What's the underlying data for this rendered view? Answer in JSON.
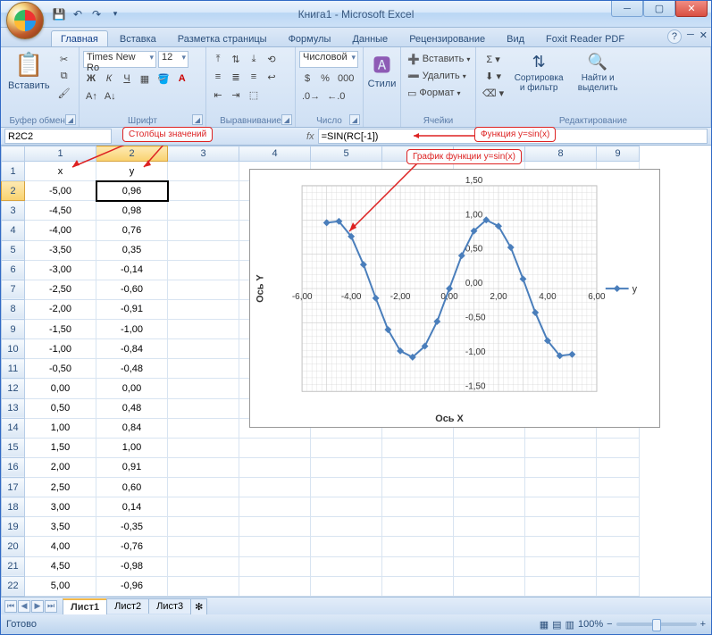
{
  "title": "Книга1 - Microsoft Excel",
  "qat_icons": [
    "save-icon",
    "undo-icon",
    "redo-icon"
  ],
  "tabs": [
    "Главная",
    "Вставка",
    "Разметка страницы",
    "Формулы",
    "Данные",
    "Рецензирование",
    "Вид",
    "Foxit Reader PDF"
  ],
  "active_tab": 0,
  "ribbon": {
    "clipboard": {
      "paste": "Вставить",
      "label": "Буфер обмена"
    },
    "font": {
      "name": "Times New Ro",
      "size": "12",
      "label": "Шрифт"
    },
    "alignment": {
      "label": "Выравнивание"
    },
    "number": {
      "format": "Числовой",
      "label": "Число"
    },
    "styles": {
      "btn": "Стили",
      "label": ""
    },
    "cells": {
      "insert": "Вставить",
      "delete": "Удалить",
      "format": "Формат",
      "label": "Ячейки"
    },
    "editing": {
      "sort": "Сортировка и фильтр",
      "find": "Найти и выделить",
      "label": "Редактирование"
    }
  },
  "namebox": "R2C2",
  "formula": "=SIN(RC[-1])",
  "callouts": {
    "columns": "Столбцы значений",
    "function": "Функция y=sin(x)",
    "chart": "График функции y=sin(x)"
  },
  "headers": {
    "x": "x",
    "y": "y"
  },
  "data_rows": [
    {
      "r": 2,
      "x": "-5,00",
      "y": "0,96"
    },
    {
      "r": 3,
      "x": "-4,50",
      "y": "0,98"
    },
    {
      "r": 4,
      "x": "-4,00",
      "y": "0,76"
    },
    {
      "r": 5,
      "x": "-3,50",
      "y": "0,35"
    },
    {
      "r": 6,
      "x": "-3,00",
      "y": "-0,14"
    },
    {
      "r": 7,
      "x": "-2,50",
      "y": "-0,60"
    },
    {
      "r": 8,
      "x": "-2,00",
      "y": "-0,91"
    },
    {
      "r": 9,
      "x": "-1,50",
      "y": "-1,00"
    },
    {
      "r": 10,
      "x": "-1,00",
      "y": "-0,84"
    },
    {
      "r": 11,
      "x": "-0,50",
      "y": "-0,48"
    },
    {
      "r": 12,
      "x": "0,00",
      "y": "0,00"
    },
    {
      "r": 13,
      "x": "0,50",
      "y": "0,48"
    },
    {
      "r": 14,
      "x": "1,00",
      "y": "0,84"
    },
    {
      "r": 15,
      "x": "1,50",
      "y": "1,00"
    },
    {
      "r": 16,
      "x": "2,00",
      "y": "0,91"
    },
    {
      "r": 17,
      "x": "2,50",
      "y": "0,60"
    },
    {
      "r": 18,
      "x": "3,00",
      "y": "0,14"
    },
    {
      "r": 19,
      "x": "3,50",
      "y": "-0,35"
    },
    {
      "r": 20,
      "x": "4,00",
      "y": "-0,76"
    },
    {
      "r": 21,
      "x": "4,50",
      "y": "-0,98"
    },
    {
      "r": 22,
      "x": "5,00",
      "y": "-0,96"
    }
  ],
  "sheet_tabs": [
    "Лист1",
    "Лист2",
    "Лист3"
  ],
  "active_sheet": 0,
  "status": "Готово",
  "zoom": "100%",
  "chart_data": {
    "type": "line",
    "xlabel": "Ось X",
    "ylabel": "Ось Y",
    "legend": "y",
    "x": [
      -5,
      -4.5,
      -4,
      -3.5,
      -3,
      -2.5,
      -2,
      -1.5,
      -1,
      -0.5,
      0,
      0.5,
      1,
      1.5,
      2,
      2.5,
      3,
      3.5,
      4,
      4.5,
      5
    ],
    "y": [
      0.96,
      0.98,
      0.76,
      0.35,
      -0.14,
      -0.6,
      -0.91,
      -1.0,
      -0.84,
      -0.48,
      0.0,
      0.48,
      0.84,
      1.0,
      0.91,
      0.6,
      0.14,
      -0.35,
      -0.76,
      -0.98,
      -0.96
    ],
    "xlim": [
      -6,
      6
    ],
    "ylim": [
      -1.5,
      1.5
    ],
    "xticks": [
      -6,
      -4,
      -2,
      0,
      2,
      4,
      6
    ],
    "yticks": [
      -1.5,
      -1.0,
      -0.5,
      0.0,
      0.5,
      1.0,
      1.5
    ]
  }
}
